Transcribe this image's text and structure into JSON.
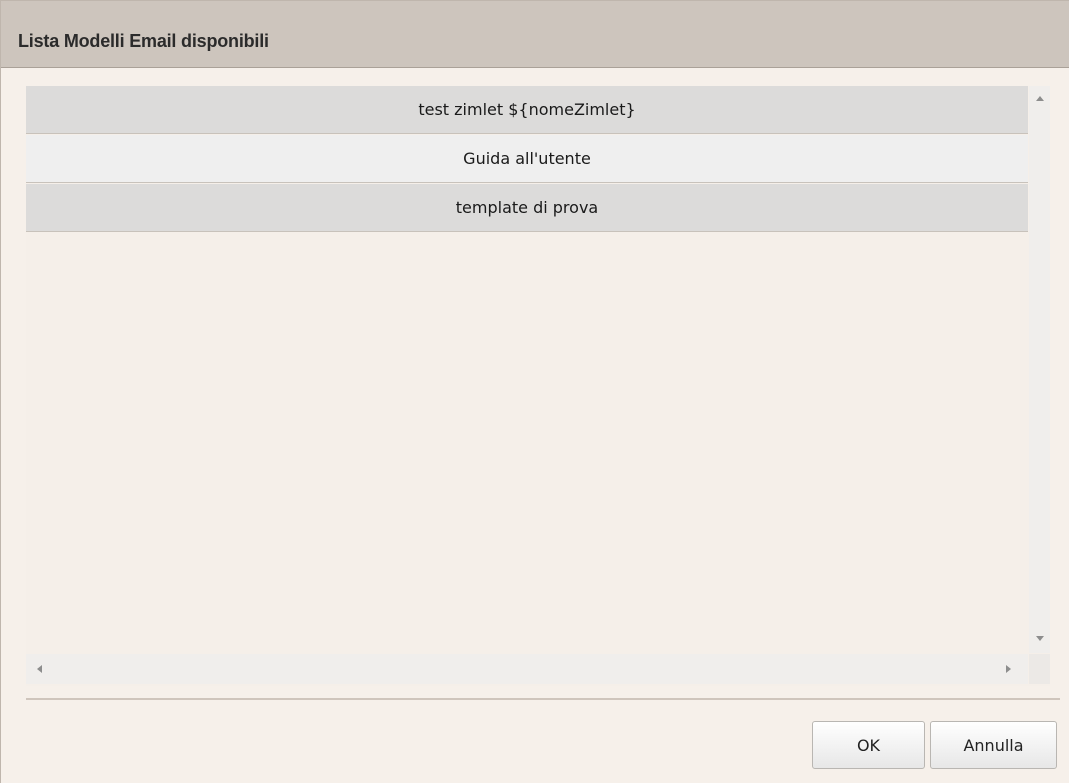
{
  "dialog": {
    "title": "Lista Modelli Email disponibili"
  },
  "templates": [
    {
      "label": "test zimlet ${nomeZimlet}"
    },
    {
      "label": "Guida all'utente"
    },
    {
      "label": "template di prova"
    }
  ],
  "buttons": {
    "ok_label": "OK",
    "cancel_label": "Annulla"
  },
  "icons": {
    "scroll_up": "chevron-up-icon",
    "scroll_down": "chevron-down-icon",
    "scroll_left": "chevron-left-icon",
    "scroll_right": "chevron-right-icon"
  },
  "colors": {
    "titlebar": "#cdc5bd",
    "background": "#f6f0ea",
    "row_alt": "#dcdbda",
    "row": "#efefef"
  }
}
